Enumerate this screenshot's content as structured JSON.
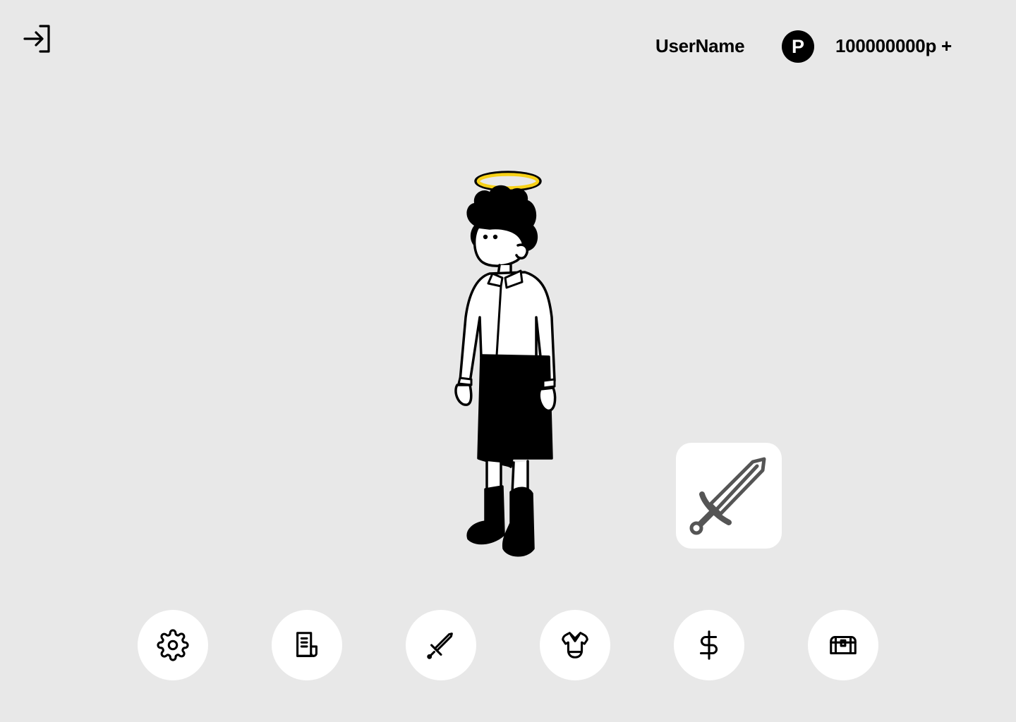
{
  "header": {
    "login_icon": "login-icon",
    "user_name": "UserName",
    "point_symbol": "P",
    "point_value": "100000000p +"
  },
  "character": {
    "icon": "angel-character"
  },
  "equipped_item": {
    "icon": "sword-icon"
  },
  "menu": [
    {
      "id": "settings",
      "icon": "gear-icon"
    },
    {
      "id": "quests",
      "icon": "document-icon"
    },
    {
      "id": "weapons",
      "icon": "sword-icon"
    },
    {
      "id": "armor",
      "icon": "armor-icon"
    },
    {
      "id": "shop",
      "icon": "dollar-icon"
    },
    {
      "id": "inventory",
      "icon": "chest-icon"
    }
  ],
  "colors": {
    "background": "#e8e8e8",
    "halo": "#f7d117",
    "icon_gray": "#555555"
  }
}
